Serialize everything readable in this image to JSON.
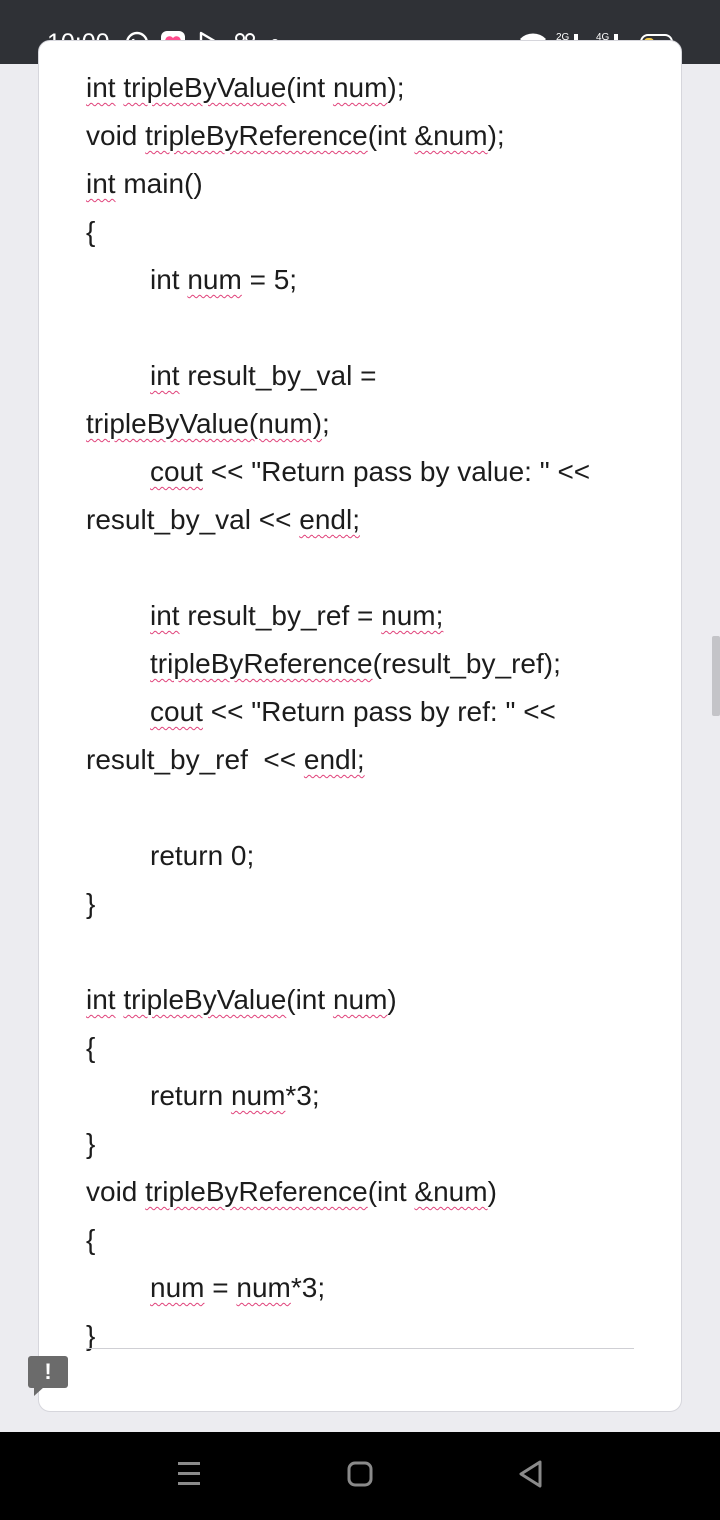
{
  "status_bar": {
    "time": "10:00",
    "network_1": "2G",
    "network_2": "4G"
  },
  "code_lines": [
    {
      "segments": [
        {
          "t": "int",
          "sq": true
        },
        {
          "t": " "
        },
        {
          "t": "tripleByValue",
          "sq": true
        },
        {
          "t": "(int "
        },
        {
          "t": "num",
          "sq": true
        },
        {
          "t": ");"
        }
      ]
    },
    {
      "segments": [
        {
          "t": "void "
        },
        {
          "t": "tripleByReference",
          "sq": true
        },
        {
          "t": "(int "
        },
        {
          "t": "&num",
          "sq": true
        },
        {
          "t": ");"
        }
      ]
    },
    {
      "segments": [
        {
          "t": "int",
          "sq": true
        },
        {
          "t": " main()"
        }
      ]
    },
    {
      "segments": [
        {
          "t": "{"
        }
      ]
    },
    {
      "indent": true,
      "segments": [
        {
          "t": "int "
        },
        {
          "t": "num",
          "sq": true
        },
        {
          "t": " = 5;"
        }
      ]
    },
    {
      "segments": []
    },
    {
      "indent": true,
      "segments": [
        {
          "t": "int",
          "sq": true
        },
        {
          "t": " result_by_val ="
        }
      ]
    },
    {
      "segments": [
        {
          "t": "tripleByValue(num)",
          "sq": true
        },
        {
          "t": ";"
        }
      ]
    },
    {
      "indent": true,
      "segments": [
        {
          "t": "cout",
          "sq": true
        },
        {
          "t": " << \"Return pass by value: \" <<"
        }
      ]
    },
    {
      "segments": [
        {
          "t": "result_by_val << "
        },
        {
          "t": "endl;",
          "sq": true
        }
      ]
    },
    {
      "segments": []
    },
    {
      "indent": true,
      "segments": [
        {
          "t": "int",
          "sq": true
        },
        {
          "t": " result_by_ref = "
        },
        {
          "t": "num;",
          "sq": true
        }
      ]
    },
    {
      "indent": true,
      "segments": [
        {
          "t": "tripleByReference",
          "sq": true
        },
        {
          "t": "(result_by_ref);"
        }
      ]
    },
    {
      "indent": true,
      "segments": [
        {
          "t": "cout",
          "sq": true
        },
        {
          "t": " << \"Return pass by ref: \" <<"
        }
      ]
    },
    {
      "segments": [
        {
          "t": "result_by_ref  << "
        },
        {
          "t": "endl;",
          "sq": true
        }
      ]
    },
    {
      "segments": []
    },
    {
      "indent": true,
      "segments": [
        {
          "t": "return 0;"
        }
      ]
    },
    {
      "segments": [
        {
          "t": "}"
        }
      ]
    },
    {
      "segments": []
    },
    {
      "segments": [
        {
          "t": "int",
          "sq": true
        },
        {
          "t": " "
        },
        {
          "t": "tripleByValue",
          "sq": true
        },
        {
          "t": "(int "
        },
        {
          "t": "num",
          "sq": true
        },
        {
          "t": ")"
        }
      ]
    },
    {
      "segments": [
        {
          "t": "{"
        }
      ]
    },
    {
      "indent": true,
      "segments": [
        {
          "t": "return "
        },
        {
          "t": "num",
          "sq": true
        },
        {
          "t": "*3;"
        }
      ]
    },
    {
      "segments": [
        {
          "t": "}"
        }
      ]
    },
    {
      "segments": [
        {
          "t": "void "
        },
        {
          "t": "tripleByReference",
          "sq": true
        },
        {
          "t": "(int "
        },
        {
          "t": "&num",
          "sq": true
        },
        {
          "t": ")"
        }
      ]
    },
    {
      "segments": [
        {
          "t": "{"
        }
      ]
    },
    {
      "indent": true,
      "segments": [
        {
          "t": "num",
          "sq": true
        },
        {
          "t": " = "
        },
        {
          "t": "num",
          "sq": true
        },
        {
          "t": "*3;"
        }
      ]
    },
    {
      "segments": [
        {
          "t": "}"
        }
      ]
    }
  ],
  "feedback_label": "!",
  "colors": {
    "status_bar": "#2f3136",
    "squiggle": "#e0427a",
    "battery": "#f2c94c",
    "whatsapp_heart": "#ff4d8d"
  },
  "icons": [
    "whatsapp-icon",
    "heart-app-icon",
    "play-icon",
    "game-icon",
    "wifi-icon",
    "battery-icon",
    "feedback-icon",
    "recents-icon",
    "home-icon",
    "back-icon"
  ]
}
